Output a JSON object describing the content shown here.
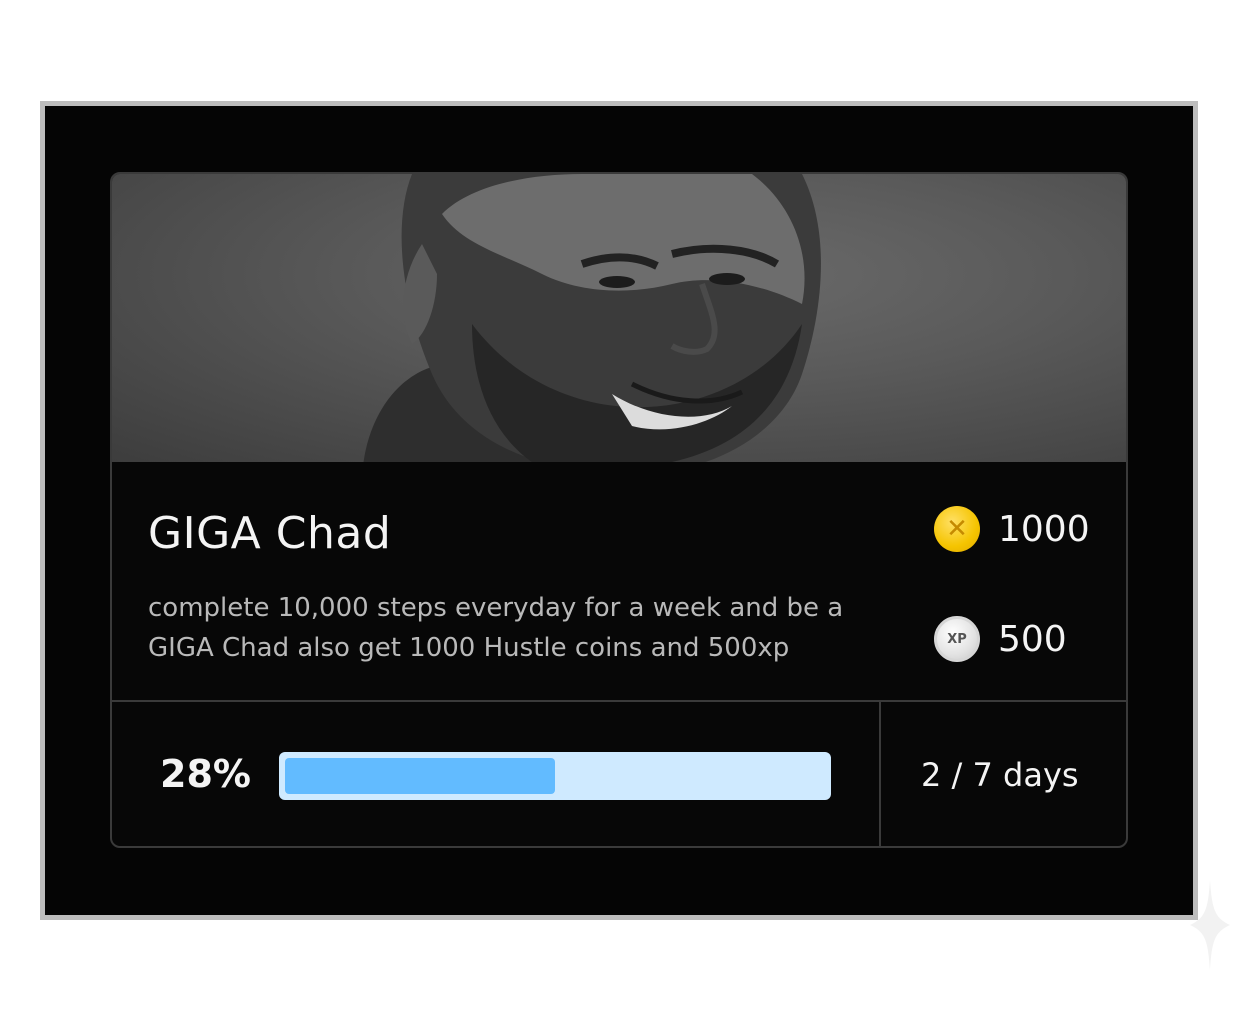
{
  "card": {
    "title": "GIGA Chad",
    "description": "complete 10,000 steps everyday for a week and be a GIGA Chad also get 1000  Hustle coins and 500xp",
    "image": "grayscale-portrait-smiling-bearded-man"
  },
  "rewards": {
    "coins": {
      "value": "1000",
      "icon": "hustle-coin-icon",
      "color": "#f5c400"
    },
    "xp": {
      "value": "500",
      "icon": "xp-badge-icon",
      "badge_text": "XP"
    }
  },
  "progress": {
    "percent_label": "28%",
    "fill_fraction": 0.5,
    "track_color": "#cfeaff",
    "fill_color": "#62bbff",
    "days_label": "2 / 7 days"
  },
  "colors": {
    "background": "#050505",
    "frame_border": "#bdbdbd",
    "text_primary": "#f4f4f4",
    "text_secondary": "#b9b9b9"
  }
}
